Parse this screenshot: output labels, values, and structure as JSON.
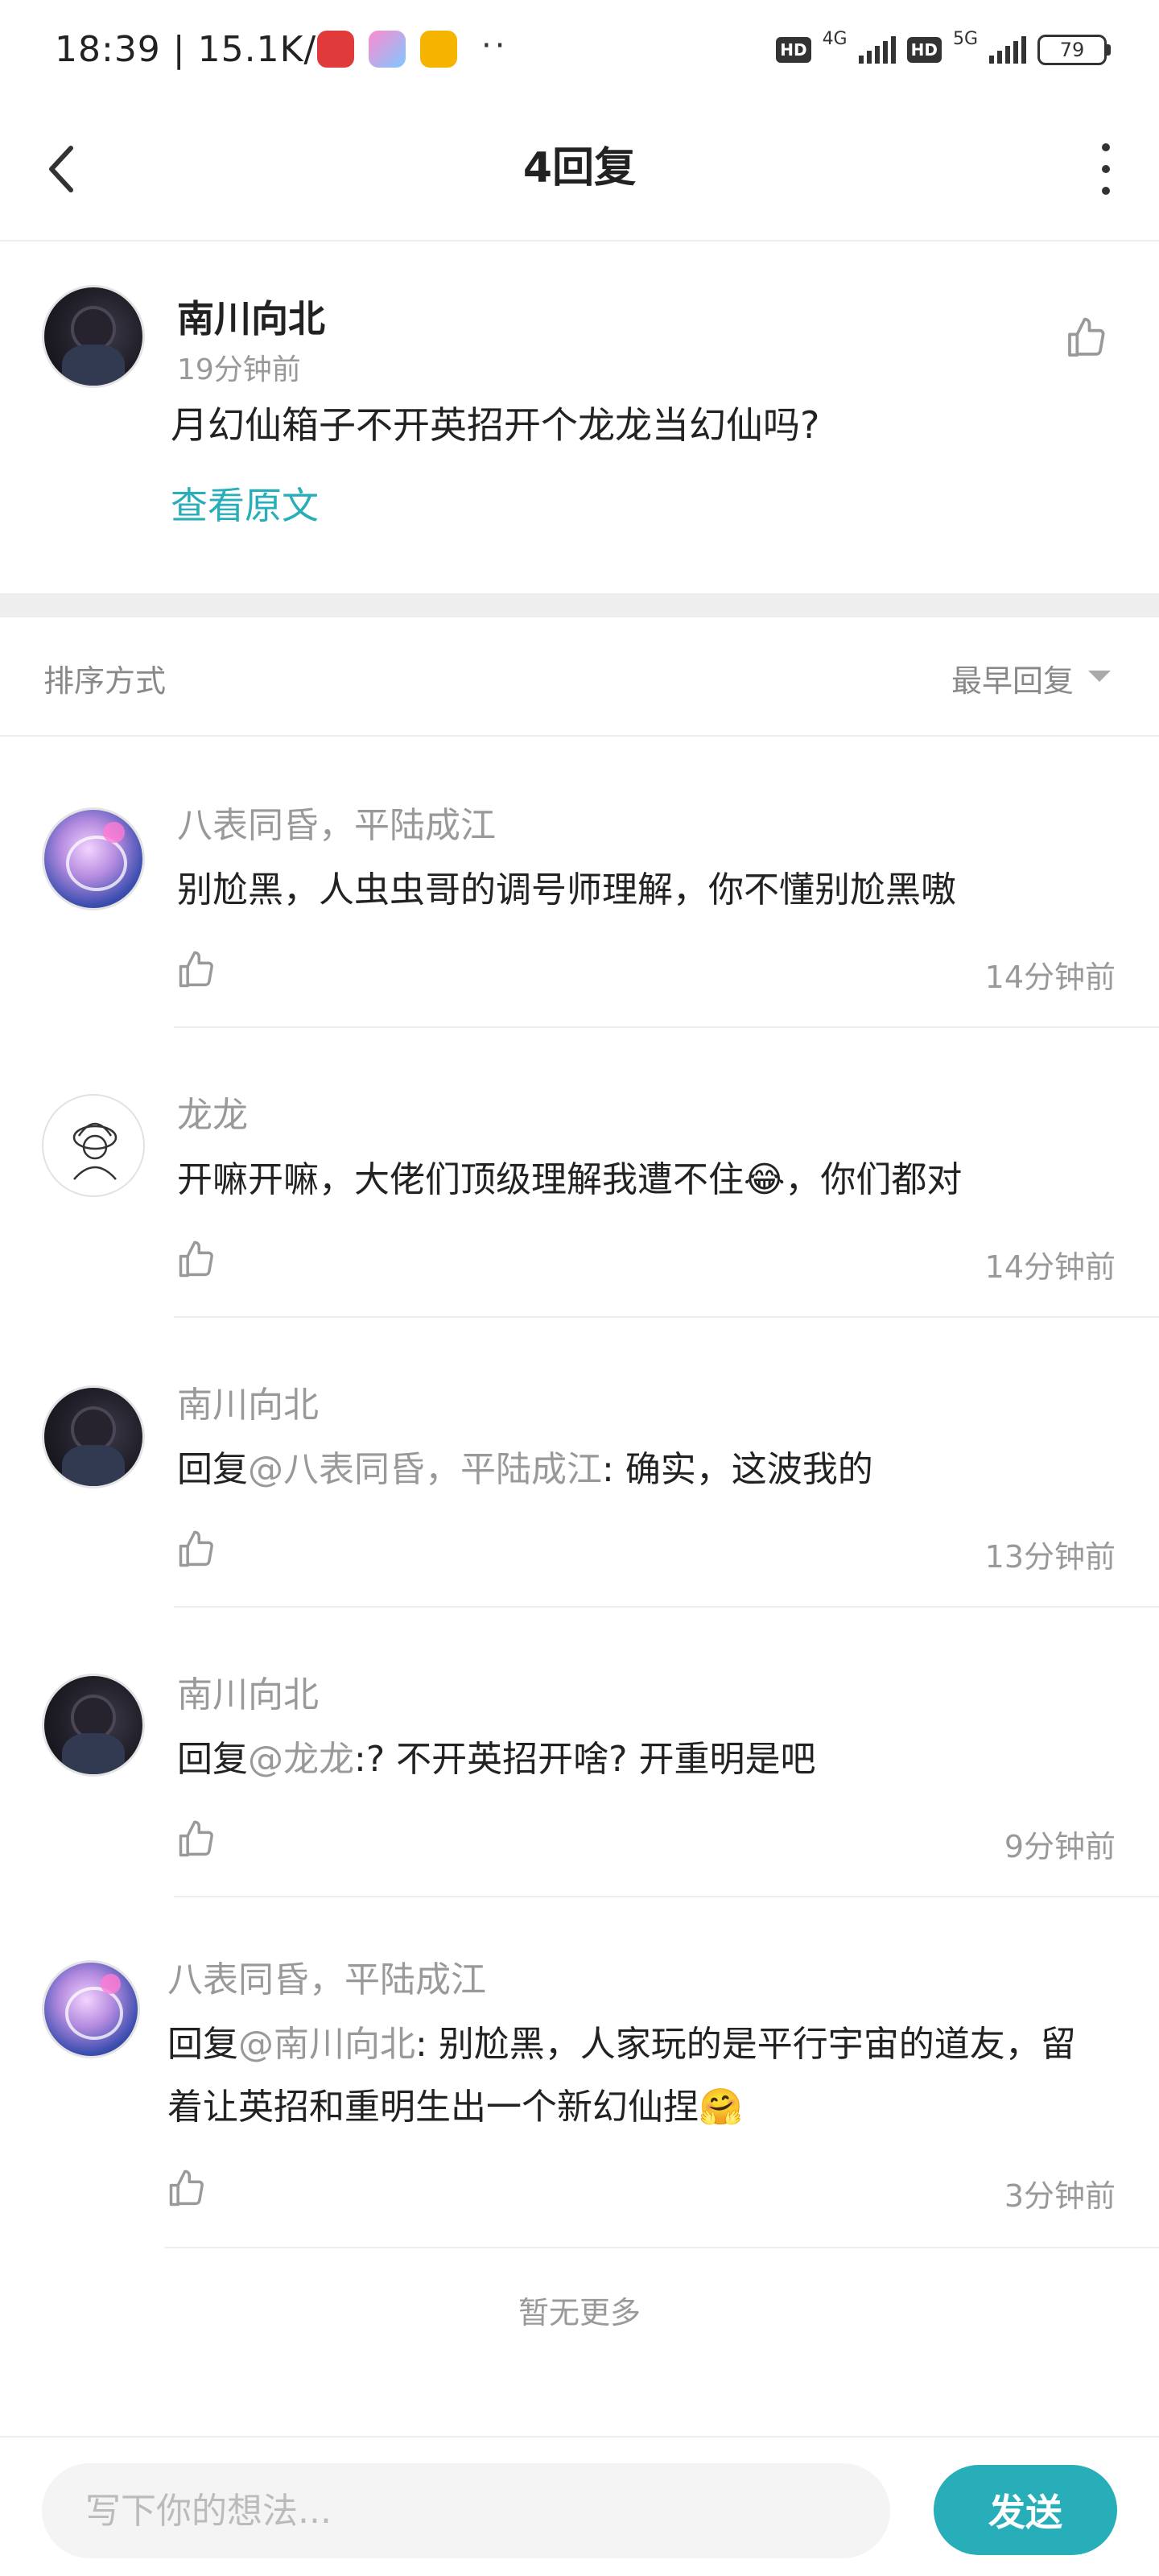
{
  "status_bar": {
    "time": "18:39 | 15.1K/s",
    "dots": "··",
    "hd1": "HD",
    "net1": "4G",
    "hd2": "HD",
    "net2": "5G",
    "battery": "79"
  },
  "header": {
    "title": "4回复"
  },
  "post": {
    "author": "南川向北",
    "time": "19分钟前",
    "text": "月幻仙箱子不开英招开个龙龙当幻仙吗?",
    "view_original": "查看原文"
  },
  "sort": {
    "label": "排序方式",
    "value": "最早回复"
  },
  "replies": [
    {
      "author": "八表同昏，平陆成江",
      "prefix": "",
      "mention": "",
      "text": "别尬黑，人虫虫哥的调号师理解，你不懂别尬黑嗷",
      "time": "14分钟前"
    },
    {
      "author": "龙龙",
      "prefix": "",
      "mention": "",
      "text": "开嘛开嘛，大佬们顶级理解我遭不住😂，你们都对",
      "time": "14分钟前"
    },
    {
      "author": "南川向北",
      "prefix": "回复",
      "mention": "@八表同昏，平陆成江",
      "text": ": 确实，这波我的",
      "time": "13分钟前"
    },
    {
      "author": "南川向北",
      "prefix": "回复",
      "mention": "@龙龙",
      "text": ":? 不开英招开啥? 开重明是吧",
      "time": "9分钟前"
    },
    {
      "author": "八表同昏，平陆成江",
      "prefix": "回复",
      "mention": "@南川向北",
      "text": ": 别尬黑，人家玩的是平行宇宙的道友，留着让英招和重明生出一个新幻仙捏🤗",
      "time": "3分钟前"
    }
  ],
  "footer_note": "暂无更多",
  "composer": {
    "placeholder": "写下你的想法...",
    "send_label": "发送"
  },
  "colors": {
    "accent": "#27aeb8",
    "muted_text": "#999999",
    "divider": "#eeeeee"
  }
}
